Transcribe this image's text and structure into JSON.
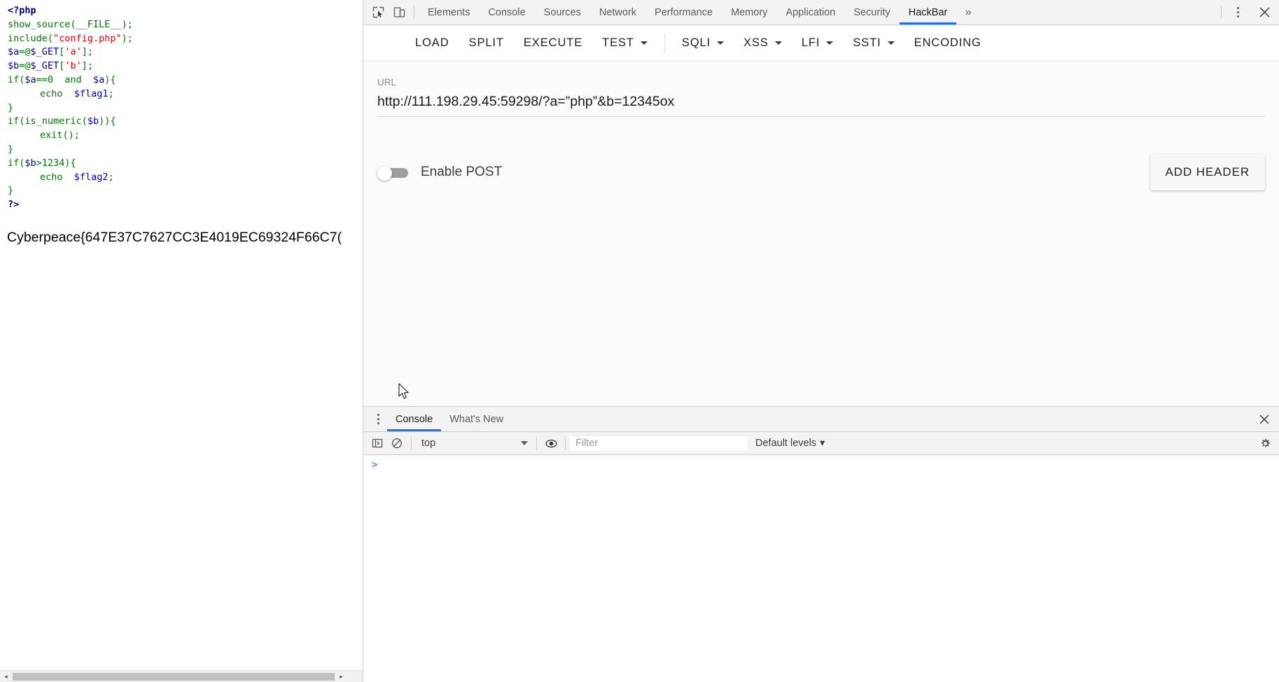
{
  "page": {
    "code_lines": [
      {
        "indent": 0,
        "parts": [
          {
            "t": "<?php",
            "c": "tok-tag"
          }
        ]
      },
      {
        "indent": 0,
        "parts": [
          {
            "t": "show_source",
            "c": "tok-fn"
          },
          {
            "t": "(",
            "c": "tok-plain"
          },
          {
            "t": "__FILE__",
            "c": "tok-fn"
          },
          {
            "t": ");",
            "c": "tok-plain"
          }
        ]
      },
      {
        "indent": 0,
        "parts": [
          {
            "t": "include",
            "c": "tok-fn"
          },
          {
            "t": "(",
            "c": "tok-plain"
          },
          {
            "t": "\"config.php\"",
            "c": "tok-str"
          },
          {
            "t": ");",
            "c": "tok-plain"
          }
        ]
      },
      {
        "indent": 0,
        "parts": [
          {
            "t": "$a",
            "c": "tok-var"
          },
          {
            "t": "=@",
            "c": "tok-plain"
          },
          {
            "t": "$_GET",
            "c": "tok-var"
          },
          {
            "t": "[",
            "c": "tok-plain"
          },
          {
            "t": "'a'",
            "c": "tok-str"
          },
          {
            "t": "];",
            "c": "tok-plain"
          }
        ]
      },
      {
        "indent": 0,
        "parts": [
          {
            "t": "$b",
            "c": "tok-var"
          },
          {
            "t": "=@",
            "c": "tok-plain"
          },
          {
            "t": "$_GET",
            "c": "tok-var"
          },
          {
            "t": "[",
            "c": "tok-plain"
          },
          {
            "t": "'b'",
            "c": "tok-str"
          },
          {
            "t": "];",
            "c": "tok-plain"
          }
        ]
      },
      {
        "indent": 0,
        "parts": [
          {
            "t": "if(",
            "c": "tok-kw"
          },
          {
            "t": "$a",
            "c": "tok-var"
          },
          {
            "t": "==0  and  ",
            "c": "tok-kw"
          },
          {
            "t": "$a",
            "c": "tok-var"
          },
          {
            "t": "){",
            "c": "tok-kw"
          }
        ]
      },
      {
        "indent": 2,
        "parts": [
          {
            "t": "echo  ",
            "c": "tok-kw"
          },
          {
            "t": "$flag1",
            "c": "tok-var"
          },
          {
            "t": ";",
            "c": "tok-plain"
          }
        ]
      },
      {
        "indent": 0,
        "parts": [
          {
            "t": "}",
            "c": "tok-kw"
          }
        ]
      },
      {
        "indent": 0,
        "parts": [
          {
            "t": "if(",
            "c": "tok-kw"
          },
          {
            "t": "is_numeric",
            "c": "tok-fn"
          },
          {
            "t": "(",
            "c": "tok-plain"
          },
          {
            "t": "$b",
            "c": "tok-var"
          },
          {
            "t": ")){",
            "c": "tok-kw"
          }
        ]
      },
      {
        "indent": 2,
        "parts": [
          {
            "t": "exit",
            "c": "tok-fn"
          },
          {
            "t": "();",
            "c": "tok-plain"
          }
        ]
      },
      {
        "indent": 0,
        "parts": [
          {
            "t": "}",
            "c": "tok-kw"
          }
        ]
      },
      {
        "indent": 0,
        "parts": [
          {
            "t": "if(",
            "c": "tok-kw"
          },
          {
            "t": "$b",
            "c": "tok-var"
          },
          {
            "t": ">1234){",
            "c": "tok-kw"
          }
        ]
      },
      {
        "indent": 2,
        "parts": [
          {
            "t": "echo  ",
            "c": "tok-kw"
          },
          {
            "t": "$flag2",
            "c": "tok-var"
          },
          {
            "t": ";",
            "c": "tok-plain"
          }
        ]
      },
      {
        "indent": 0,
        "parts": [
          {
            "t": "}",
            "c": "tok-kw"
          }
        ]
      },
      {
        "indent": 0,
        "parts": [
          {
            "t": "?>",
            "c": "tok-tag"
          }
        ]
      }
    ],
    "flag_text": "Cyberpeace{647E37C7627CC3E4019EC69324F66C7(",
    "scrollbar": {
      "left_arrow": "◂",
      "right_arrow": "▸"
    }
  },
  "devtools": {
    "tabs": [
      {
        "label": "Elements",
        "active": false
      },
      {
        "label": "Console",
        "active": false
      },
      {
        "label": "Sources",
        "active": false
      },
      {
        "label": "Network",
        "active": false
      },
      {
        "label": "Performance",
        "active": false
      },
      {
        "label": "Memory",
        "active": false
      },
      {
        "label": "Application",
        "active": false
      },
      {
        "label": "Security",
        "active": false
      },
      {
        "label": "HackBar",
        "active": true
      }
    ],
    "more_tabs_label": "»",
    "accent_color": "#1a73e8",
    "icons": {
      "inspect": "inspect-element-icon",
      "device": "device-toolbar-icon",
      "kebab": "more-options-icon",
      "close": "close-devtools-icon"
    }
  },
  "hackbar": {
    "buttons": [
      {
        "label": "LOAD",
        "caret": false,
        "divider_after": false
      },
      {
        "label": "SPLIT",
        "caret": false,
        "divider_after": false
      },
      {
        "label": "EXECUTE",
        "caret": false,
        "divider_after": false
      },
      {
        "label": "TEST",
        "caret": true,
        "divider_after": true
      },
      {
        "label": "SQLI",
        "caret": true,
        "divider_after": false
      },
      {
        "label": "XSS",
        "caret": true,
        "divider_after": false
      },
      {
        "label": "LFI",
        "caret": true,
        "divider_after": false
      },
      {
        "label": "SSTI",
        "caret": true,
        "divider_after": false
      },
      {
        "label": "ENCODING",
        "caret": false,
        "divider_after": false
      }
    ],
    "url": {
      "label": "URL",
      "value": "http://111.198.29.45:59298/?a=”php”&b=12345ox"
    },
    "post_toggle": {
      "label": "Enable POST",
      "enabled": false
    },
    "add_header_label": "ADD HEADER"
  },
  "drawer": {
    "tabs": [
      {
        "label": "Console",
        "active": true
      },
      {
        "label": "What's New",
        "active": false
      }
    ],
    "close_label": "✕",
    "kebab_label": "more-tools-icon",
    "filterbar": {
      "context": "top",
      "filter_placeholder": "Filter",
      "levels": "Default levels",
      "levels_caret": "▾",
      "icons": {
        "sidebar": "console-sidebar-icon",
        "clear": "clear-console-icon",
        "eye": "live-expression-icon",
        "gear": "console-settings-icon"
      }
    },
    "prompt_glyph": ">"
  }
}
